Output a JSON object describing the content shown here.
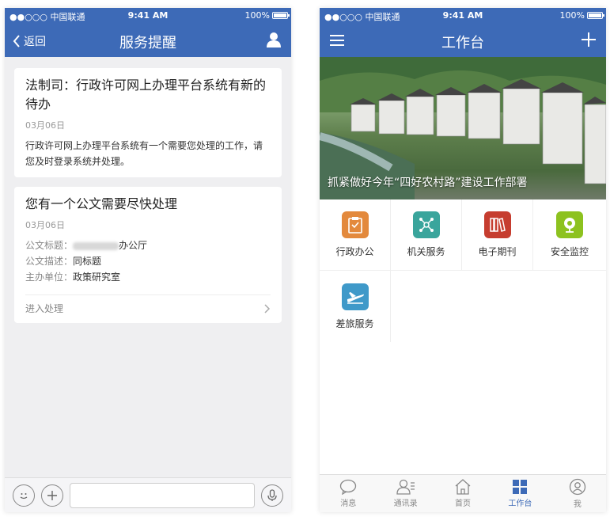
{
  "status_bar": {
    "carrier": "●●○○○ 中国联通",
    "time": "9:41 AM",
    "battery": "100%"
  },
  "left": {
    "nav": {
      "back_label": "返回",
      "title": "服务提醒"
    },
    "card1": {
      "title": "法制司：行政许可网上办理平台系统有新的待办",
      "date": "03月06日",
      "body": "行政许可网上办理平台系统有一个需要您处理的工作，请您及时登录系统并处理。"
    },
    "card2": {
      "title": "您有一个公文需要尽快处理",
      "date": "03月06日",
      "fields": [
        {
          "key": "公文标题：",
          "value": "办公厅"
        },
        {
          "key": "公文描述：",
          "value": "同标题"
        },
        {
          "key": "主办单位：",
          "value": "政策研究室"
        }
      ],
      "action_label": "进入处理"
    },
    "input": {
      "value": "",
      "placeholder": ""
    }
  },
  "right": {
    "nav": {
      "title": "工作台"
    },
    "banner": {
      "caption": "抓紧做好今年“四好农村路”建设工作部署"
    },
    "apps": [
      {
        "label": "行政办公",
        "color": "#e3893c",
        "icon": "clipboard-icon"
      },
      {
        "label": "机关服务",
        "color": "#3aa59c",
        "icon": "network-icon"
      },
      {
        "label": "电子期刊",
        "color": "#c63d2f",
        "icon": "books-icon"
      },
      {
        "label": "安全监控",
        "color": "#8dc21f",
        "icon": "camera-icon"
      },
      {
        "label": "差旅服务",
        "color": "#3f99c9",
        "icon": "airplane-icon"
      }
    ],
    "tabs": [
      {
        "label": "消息",
        "icon": "chat-bubble-icon"
      },
      {
        "label": "通讯录",
        "icon": "contacts-icon"
      },
      {
        "label": "首页",
        "icon": "home-icon"
      },
      {
        "label": "工作台",
        "icon": "grid-icon"
      },
      {
        "label": "我",
        "icon": "profile-icon"
      }
    ]
  }
}
